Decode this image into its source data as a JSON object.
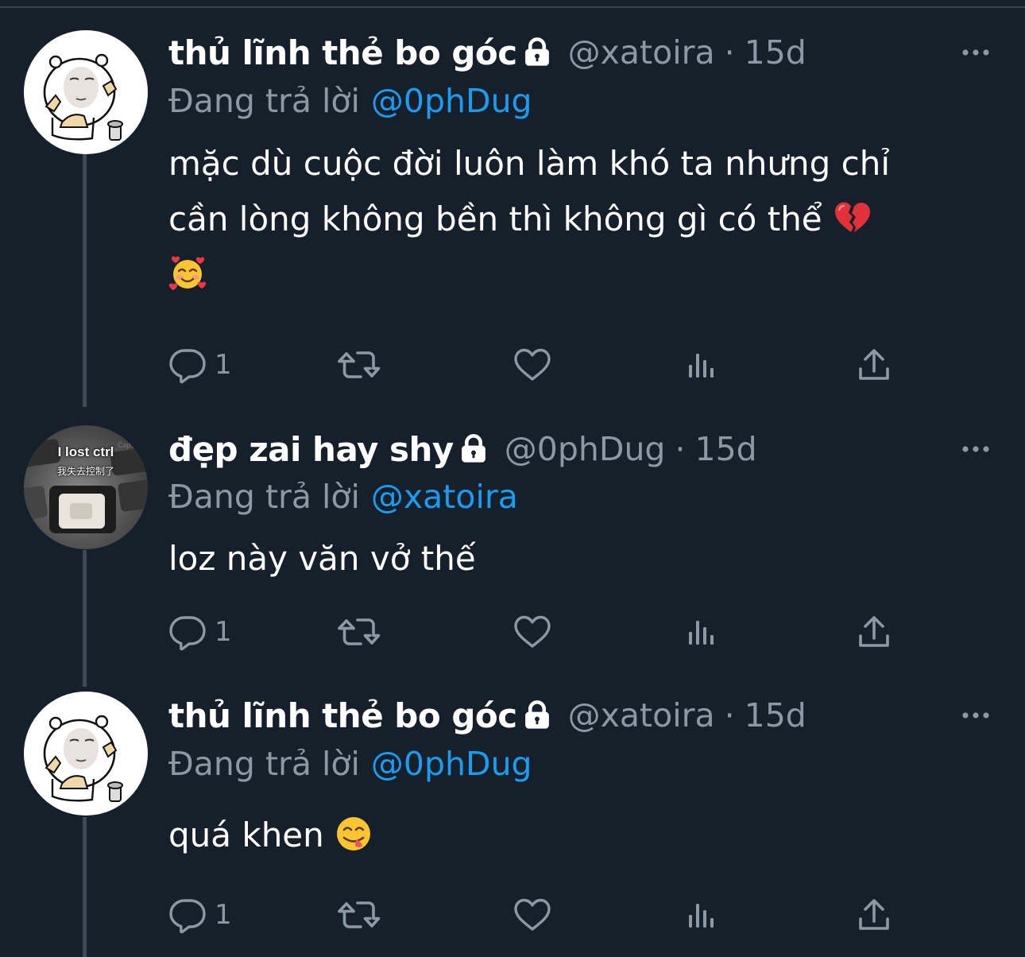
{
  "colors": {
    "background": "#15202b",
    "text_primary": "#ffffff",
    "text_secondary": "#8b98a5",
    "accent": "#1d9bf0",
    "thread_line": "#3d4954"
  },
  "icons": {
    "lock": "lock-icon",
    "more": "more-icon",
    "reply": "reply-icon",
    "retweet": "retweet-icon",
    "like": "heart-icon",
    "views": "views-icon",
    "share": "share-icon"
  },
  "reply_label": "Đang trả lời",
  "tweets": [
    {
      "name": "thủ lĩnh thẻ bo góc",
      "handle": "@xatoira",
      "separator": "·",
      "time": "15d",
      "reply_to": "@0phDug",
      "body_lines": [
        "mặc dù cuộc đời luôn làm khó ta nhưng chỉ",
        "cần lòng không bền thì không gì có thể"
      ],
      "reply_count": "1",
      "emojis": [
        "broken-heart-emoji",
        "smiling-face-with-hearts-emoji"
      ]
    },
    {
      "name": "đẹp zai hay shy",
      "handle": "@0phDug",
      "separator": "·",
      "time": "15d",
      "reply_to": "@xatoira",
      "body_lines": [
        "loz này văn vở thế"
      ],
      "reply_count": "1",
      "avatar_caption_1": "I lost ctrl",
      "avatar_caption_2": "我失去控制了"
    },
    {
      "name": "thủ lĩnh thẻ bo góc",
      "handle": "@xatoira",
      "separator": "·",
      "time": "15d",
      "reply_to": "@0phDug",
      "body_lines": [
        "quá khen"
      ],
      "reply_count": "1",
      "emojis": [
        "face-savoring-food-emoji"
      ]
    }
  ]
}
